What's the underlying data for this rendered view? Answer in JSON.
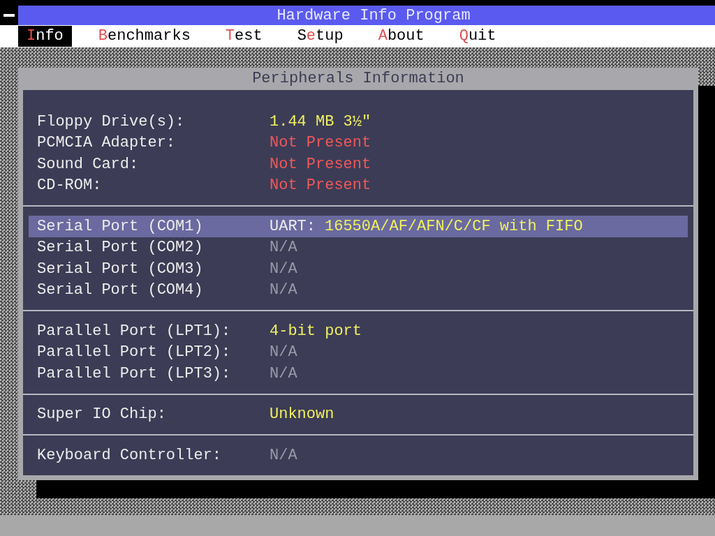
{
  "window": {
    "title": "Hardware Info Program"
  },
  "menu": [
    {
      "hotkey": "I",
      "rest": "nfo",
      "selected": true
    },
    {
      "hotkey": "B",
      "rest": "enchmarks",
      "selected": false
    },
    {
      "hotkey": "T",
      "rest": "est",
      "selected": false
    },
    {
      "hotkey_prefix": "S",
      "hotkey": "e",
      "rest": "tup",
      "selected": false
    },
    {
      "hotkey": "A",
      "rest": "bout",
      "selected": false
    },
    {
      "hotkey": "Q",
      "rest": "uit",
      "selected": false
    }
  ],
  "dialog": {
    "title": "Peripherals Information",
    "sections": [
      {
        "rows": [
          {
            "label": "Floppy Drive(s):",
            "value": "1.44 MB 3½\"",
            "kind": "found",
            "selected": false
          },
          {
            "label": "PCMCIA Adapter:",
            "value": "Not Present",
            "kind": "absent",
            "selected": false
          },
          {
            "label": "Sound Card:",
            "value": "Not Present",
            "kind": "absent",
            "selected": false
          },
          {
            "label": "CD-ROM:",
            "value": "Not Present",
            "kind": "absent",
            "selected": false
          }
        ]
      },
      {
        "rows": [
          {
            "label": "Serial Port (COM1)",
            "value_prefix": "UART:",
            "value": "16550A/AF/AFN/C/CF with FIFO",
            "kind": "found",
            "selected": true
          },
          {
            "label": "Serial Port (COM2)",
            "value": "N/A",
            "kind": "na",
            "selected": false
          },
          {
            "label": "Serial Port (COM3)",
            "value": "N/A",
            "kind": "na",
            "selected": false
          },
          {
            "label": "Serial Port (COM4)",
            "value": "N/A",
            "kind": "na",
            "selected": false
          }
        ]
      },
      {
        "rows": [
          {
            "label": "Parallel Port (LPT1):",
            "value": "4-bit port",
            "kind": "found",
            "selected": false
          },
          {
            "label": "Parallel Port (LPT2):",
            "value": "N/A",
            "kind": "na",
            "selected": false
          },
          {
            "label": "Parallel Port (LPT3):",
            "value": "N/A",
            "kind": "na",
            "selected": false
          }
        ]
      },
      {
        "rows": [
          {
            "label": "Super IO Chip:",
            "value": "Unknown",
            "kind": "found",
            "selected": false
          }
        ]
      },
      {
        "rows": [
          {
            "label": "Keyboard Controller:",
            "value": "N/A",
            "kind": "na",
            "selected": false
          }
        ]
      }
    ]
  }
}
